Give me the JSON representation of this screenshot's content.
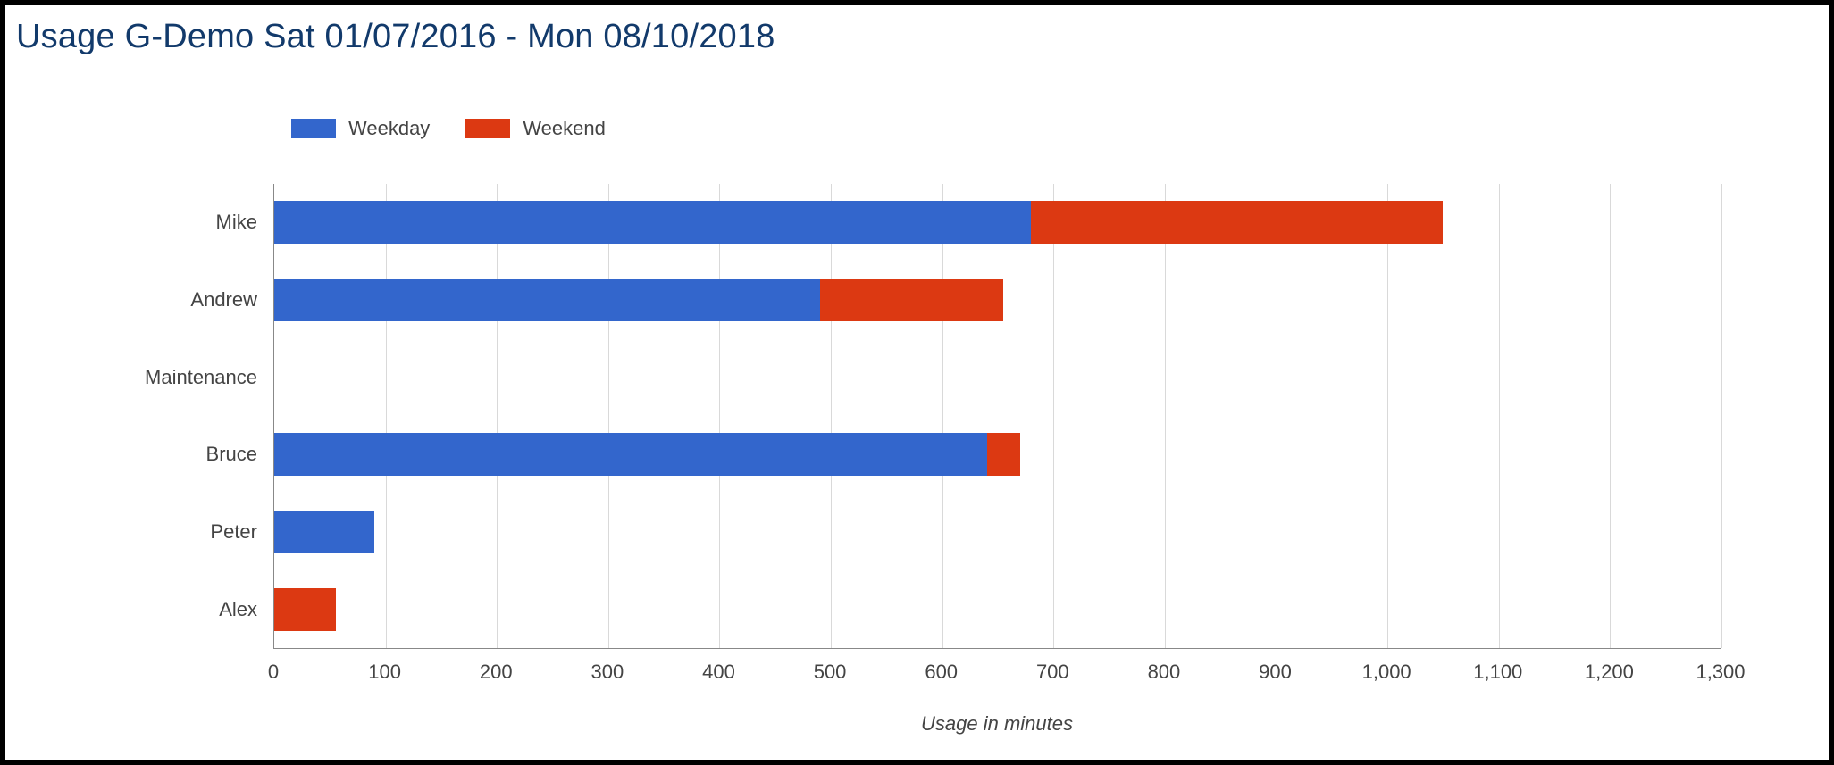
{
  "title": "Usage G-Demo Sat 01/07/2016 - Mon 08/10/2018",
  "legend": {
    "weekday": "Weekday",
    "weekend": "Weekend"
  },
  "axis": {
    "x_title": "Usage in minutes"
  },
  "colors": {
    "weekday": "#3366cc",
    "weekend": "#dc3912",
    "title": "#123a6b",
    "grid": "#d9d9d9"
  },
  "chart_data": {
    "type": "bar",
    "orientation": "horizontal",
    "stacked": true,
    "categories": [
      "Mike",
      "Andrew",
      "Maintenance",
      "Bruce",
      "Peter",
      "Alex"
    ],
    "series": [
      {
        "name": "Weekday",
        "values": [
          680,
          490,
          0,
          640,
          90,
          0
        ]
      },
      {
        "name": "Weekend",
        "values": [
          370,
          165,
          0,
          30,
          0,
          55
        ]
      }
    ],
    "xlabel": "Usage in minutes",
    "ylabel": "",
    "xlim": [
      0,
      1300
    ],
    "x_ticks": [
      0,
      100,
      200,
      300,
      400,
      500,
      600,
      700,
      800,
      900,
      1000,
      1100,
      1200,
      1300
    ],
    "x_tick_labels": [
      "0",
      "100",
      "200",
      "300",
      "400",
      "500",
      "600",
      "700",
      "800",
      "900",
      "1,000",
      "1,100",
      "1,200",
      "1,300"
    ],
    "title": "Usage G-Demo Sat 01/07/2016 - Mon 08/10/2018",
    "legend_position": "top"
  }
}
